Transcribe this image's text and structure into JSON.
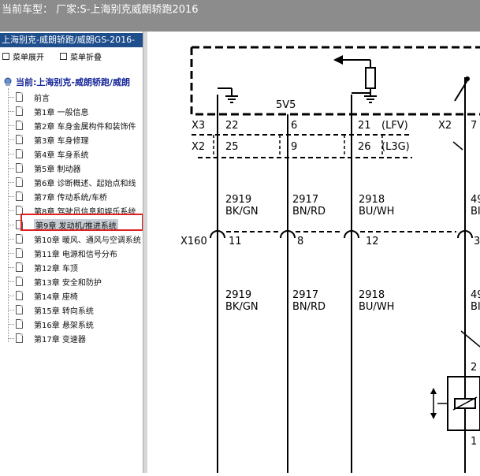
{
  "window": {
    "title": "当前车型： 厂家:S-上海别克威朗轿跑2016"
  },
  "sidebar": {
    "header": "上海别克-威朗轿跑/威朗GS-2016-",
    "expand_label": "菜单展开",
    "collapse_label": "菜单折叠",
    "root_label": "当前:上海别克-威朗轿跑/威朗",
    "items": [
      {
        "label": "前言"
      },
      {
        "label": "第1章 一般信息"
      },
      {
        "label": "第2章 车身金属构件和装饰件"
      },
      {
        "label": "第3章 车身修理"
      },
      {
        "label": "第4章 车身系统"
      },
      {
        "label": "第5章 制动器"
      },
      {
        "label": "第6章 诊断概述、起始点和线"
      },
      {
        "label": "第7章 传动系统/车桥"
      },
      {
        "label": "第8章 驾驶员信息和娱乐系统"
      },
      {
        "label": "第9章 发动机/推进系统"
      },
      {
        "label": "第10章 暖风、通风与空调系统"
      },
      {
        "label": "第11章 电源和信号分布"
      },
      {
        "label": "第12章 车顶"
      },
      {
        "label": "第13章 安全和防护"
      },
      {
        "label": "第14章 座椅"
      },
      {
        "label": "第15章 转向系统"
      },
      {
        "label": "第16章 悬架系统"
      },
      {
        "label": "第17章 变速器"
      }
    ],
    "selected_index": 9
  },
  "diagram": {
    "labels": {
      "v5": "5V5",
      "x3": "X3",
      "x2a": "X2",
      "x2b": "X2",
      "x2c": "X2",
      "x160": "X160",
      "lfv": "(LFV)",
      "l3g": "(L3G)",
      "pin22": "22",
      "pin6": "6",
      "pin21": "21",
      "pin7": "7",
      "pin25": "25",
      "pin9": "9",
      "pin26": "26",
      "pin11": "11",
      "pin8": "8",
      "pin12": "12",
      "pin3": "3",
      "pin2": "2",
      "pin1": "1",
      "c1_num_top": "2919",
      "c1_color_top": "BK/GN",
      "c2_num_top": "2917",
      "c2_color_top": "BN/RD",
      "c3_num_top": "2918",
      "c3_color_top": "BU/WH",
      "c4_num_top": "49",
      "c4_color_top": "BI",
      "c1_num_bot": "2919",
      "c1_color_bot": "BK/GN",
      "c2_num_bot": "2917",
      "c2_color_bot": "BN/RD",
      "c3_num_bot": "2918",
      "c3_color_bot": "BU/WH",
      "c4_num_bot": "49",
      "c4_color_bot": "BI"
    }
  },
  "colors": {
    "titlebar": "#8c8c8c",
    "tree_header": "#1e4e8c",
    "selection_box": "#e02020",
    "root_label": "#1a2a9a"
  }
}
